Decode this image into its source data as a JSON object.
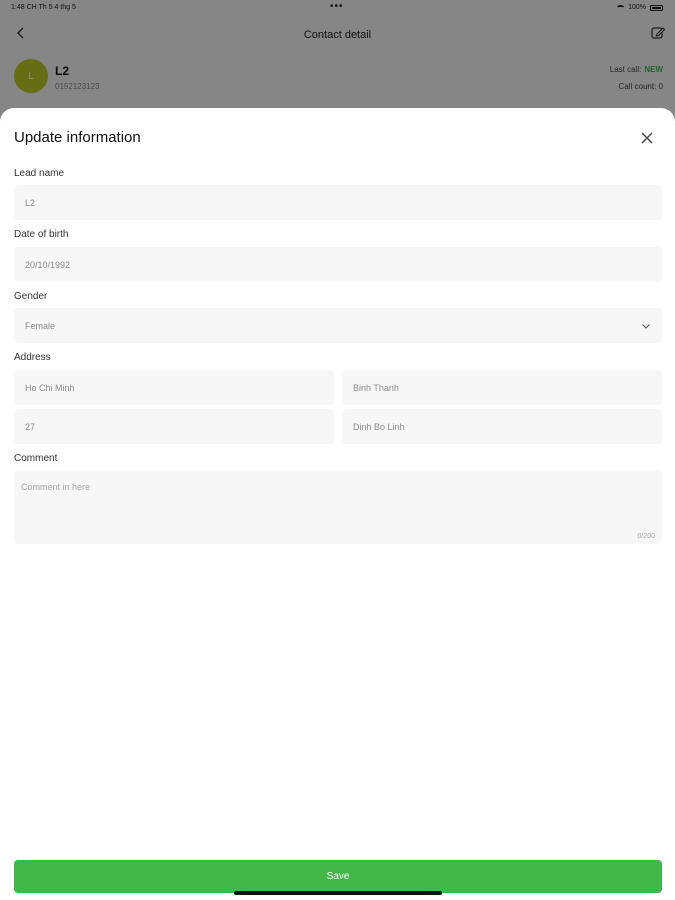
{
  "status_bar": {
    "time": "1:48 CH",
    "date": "Th 5 4 thg 5",
    "battery": "100%"
  },
  "nav": {
    "title": "Contact detail",
    "back_icon": "chevron-left-icon",
    "edit_icon": "edit-icon"
  },
  "contact": {
    "avatar_initial": "L",
    "name": "L2",
    "phone": "0152123123",
    "last_call_label": "Last call:",
    "last_call_status": "NEW",
    "call_count": "Call count: 0"
  },
  "sheet": {
    "title": "Update information",
    "close_icon": "close-icon",
    "lead_name": {
      "label": "Lead name",
      "value": "L2"
    },
    "date_of_birth": {
      "label": "Date of birth",
      "value": "20/10/1992"
    },
    "gender": {
      "label": "Gender",
      "value": "Female"
    },
    "address": {
      "label": "Address",
      "city": "Ho Chi Minh",
      "district": "Binh Thanh",
      "street_number": "27",
      "street": "Dinh Bo Linh"
    },
    "comment": {
      "label": "Comment",
      "placeholder": "Comment in here",
      "counter": "0/200"
    },
    "save_label": "Save"
  },
  "colors": {
    "accent": "#41b649",
    "avatar": "#b9c927",
    "status_new": "#39b54a"
  }
}
